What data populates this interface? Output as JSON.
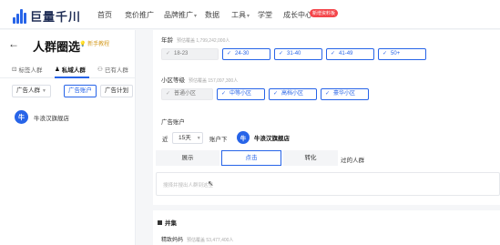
{
  "brand": {
    "name": "巨量千川",
    "accent": "#2764e8"
  },
  "nav": {
    "items": [
      "首页",
      "竞价推广",
      "品牌推广",
      "数据",
      "工具",
      "学堂",
      "成长中心"
    ],
    "badge": "新增资料板"
  },
  "left": {
    "title": "人群圈选",
    "newbie_label": "新手教程",
    "tabs": [
      "标签人群",
      "私域人群",
      "已有人群"
    ],
    "filters": [
      "广告人群",
      "广告账户",
      "广告计划"
    ],
    "account_name": "牛浪汉旗舰店",
    "account_avatar": "牛"
  },
  "main": {
    "age": {
      "label": "年龄",
      "estimate": "预估覆盖 1,799,242,000人",
      "options": [
        "18-23",
        "24-30",
        "31-40",
        "41-49",
        "50+"
      ]
    },
    "community": {
      "label": "小区等级",
      "estimate": "预估覆盖 157,097,300人",
      "options": [
        "普通小区",
        "中等小区",
        "高档小区",
        "豪华小区"
      ]
    },
    "ad_account": {
      "label": "广告账户",
      "prefix": "近",
      "days": "15天",
      "suffix": "账户下",
      "avatar": "牛",
      "account": "牛浪汉旗舰店",
      "segments": [
        "展示",
        "点击",
        "转化"
      ],
      "segment_suffix": "过的人群",
      "search_placeholder": "搜择并搜出人群到这里"
    },
    "intersect": {
      "label": "并集",
      "precise_label": "精致妈妈",
      "precise_estimate": "预估覆盖 53,477,400人"
    }
  }
}
